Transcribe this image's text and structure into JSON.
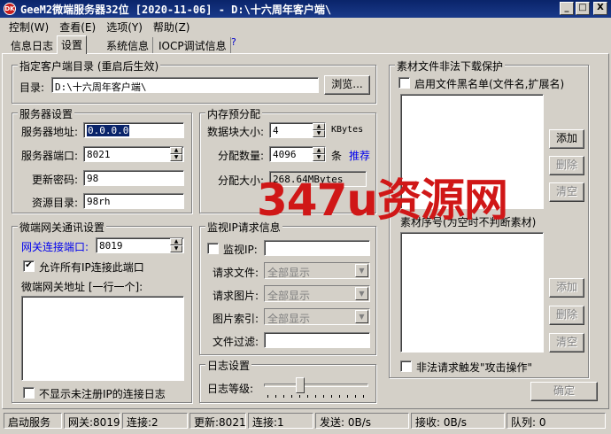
{
  "window": {
    "title": "GeeM2微端服务器32位 [2020-11-06] - D:\\十六周年客户端\\",
    "app_icon": "DK",
    "minimize": "_",
    "maximize": "□",
    "close": "X"
  },
  "menu": [
    "控制(W)",
    "查看(E)",
    "选项(Y)",
    "帮助(Z)"
  ],
  "tabs": [
    "信息日志",
    "设置",
    "系统信息",
    "IOCP调试信息"
  ],
  "tab_help": "?",
  "client_dir": {
    "legend": "指定客户端目录 (重启后生效)",
    "label": "目录:",
    "value": "D:\\十六周年客户端\\",
    "browse": "浏览..."
  },
  "server": {
    "legend": "服务器设置",
    "addr_label": "服务器地址:",
    "addr_value": "0.0.0.0",
    "port_label": "服务器端口:",
    "port_value": "8021",
    "pwd_label": "更新密码:",
    "pwd_value": "98",
    "res_label": "资源目录:",
    "res_value": "98rh"
  },
  "memory": {
    "legend": "内存预分配",
    "block_label": "数据块大小:",
    "block_value": "4",
    "block_unit": "KBytes",
    "count_label": "分配数量:",
    "count_value": "4096",
    "count_unit": "条",
    "recommend": "推荐",
    "size_label": "分配大小:",
    "size_value": "268.64MBytes"
  },
  "gateway": {
    "legend": "微端网关通讯设置",
    "port_label": "网关连接端口:",
    "port_value": "8019",
    "allow_all_label": "允许所有IP连接此端口",
    "allow_all_checked": "✔",
    "addr_list_label": "微端网关地址 [一行一个]:",
    "hide_log_label": "不显示未注册IP的连接日志"
  },
  "monitor": {
    "legend": "监视IP请求信息",
    "ip_label": "监视IP:",
    "file_label": "请求文件:",
    "file_value": "全部显示",
    "img_label": "请求图片:",
    "img_value": "全部显示",
    "idx_label": "图片索引:",
    "idx_value": "全部显示",
    "filter_label": "文件过滤:"
  },
  "log": {
    "legend": "日志设置",
    "level_label": "日志等级:",
    "level_value": 0.33
  },
  "protect": {
    "legend": "素材文件非法下载保护",
    "blacklist_label": "启用文件黑名单(文件名,扩展名)",
    "add": "添加",
    "delete": "删除",
    "clear": "清空",
    "seq_label": "素材序号(为空时不判断素材)",
    "add2": "添加",
    "delete2": "删除",
    "clear2": "清空",
    "attack_label": "非法请求触发\"攻击操作\""
  },
  "ok_button": "确定",
  "status": {
    "start": "启动服务",
    "gateway": "网关:8019",
    "gw_conn": "连接:2",
    "update": "更新:8021",
    "up_conn": "连接:1",
    "send": "发送: 0B/s",
    "recv": "接收: 0B/s",
    "queue": "队列: 0"
  },
  "watermark": "347u资源网"
}
